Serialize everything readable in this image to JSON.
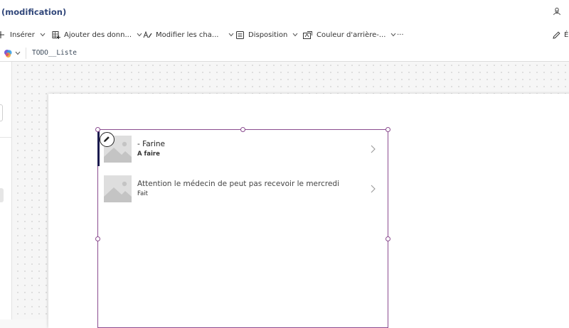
{
  "app": {
    "title": "(modification)"
  },
  "toolbar": {
    "insert": "Insérer",
    "add_data": "Ajouter des donn...",
    "modify_fields": "Modifier les cha...",
    "layout": "Disposition",
    "background": "Couleur d'arrière-...",
    "more": "···",
    "edit": "É"
  },
  "formula": {
    "expression": "TODO__Liste"
  },
  "gallery": {
    "items": [
      {
        "title": "- Farine",
        "subtitle": "A faire"
      },
      {
        "title": "Attention le médecin de peut pas recevoir le mercredi",
        "subtitle": "Fait"
      }
    ]
  },
  "colors": {
    "accent": "#8a4b8f",
    "title": "#31477a",
    "selection_bar": "#1b1b4f"
  }
}
